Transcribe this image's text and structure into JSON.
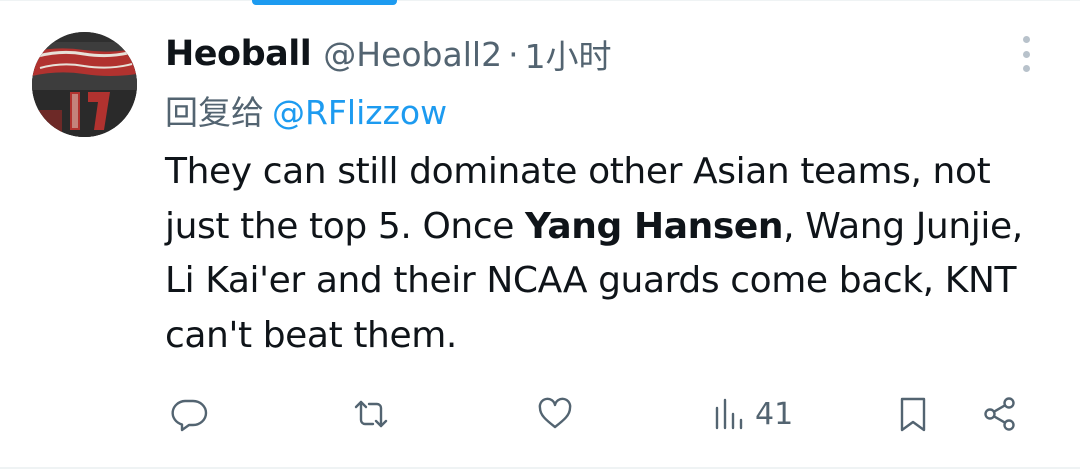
{
  "tweet": {
    "display_name": "Heoball",
    "handle": "@Heoball2",
    "separator": "·",
    "time": "1小时",
    "reply_prefix": "回复给",
    "reply_mention": "@RFlizzow",
    "text_before": "They can still dominate other Asian teams, not just the top 5. Once ",
    "text_bold": "Yang Hansen",
    "text_after": ", Wang Junjie, Li Kai'er and their NCAA guards come back, KNT can't beat them."
  },
  "actions": {
    "reply_icon": "reply-icon",
    "retweet_icon": "retweet-icon",
    "like_icon": "heart-icon",
    "views_icon": "bar-chart-icon",
    "views_count": "41",
    "bookmark_icon": "bookmark-icon",
    "share_icon": "share-icon"
  },
  "colors": {
    "accent": "#1d9bf0",
    "text_primary": "#0f1419",
    "text_secondary": "#536471"
  }
}
